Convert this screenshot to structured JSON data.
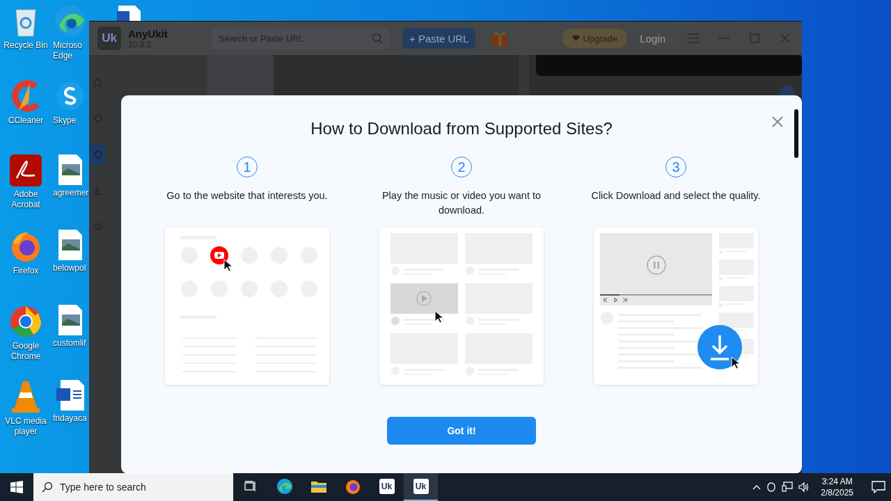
{
  "desktop_icons": [
    {
      "label": "Recycle Bin",
      "kind": "recycle"
    },
    {
      "label": "Microso Edge",
      "kind": "edge"
    },
    {
      "label": "CCleaner",
      "kind": "ccleaner"
    },
    {
      "label": "Skype",
      "kind": "skype"
    },
    {
      "label": "Adobe Acrobat",
      "kind": "acrobat"
    },
    {
      "label": "agreemer",
      "kind": "image"
    },
    {
      "label": "Firefox",
      "kind": "firefox"
    },
    {
      "label": "belowpol",
      "kind": "image"
    },
    {
      "label": "Google Chrome",
      "kind": "chrome"
    },
    {
      "label": "customlif",
      "kind": "image"
    },
    {
      "label": "VLC media player",
      "kind": "vlc"
    },
    {
      "label": "fridayaca",
      "kind": "word"
    }
  ],
  "app": {
    "logo_text": "Uk",
    "name": "AnyUkit",
    "version": "10.8.2",
    "search": {
      "placeholder": "Search or Paste URL"
    },
    "paste_button": "+ Paste URL",
    "upgrade_button": "Upgrade",
    "login": "Login",
    "sidebar": [
      {
        "kind": "home",
        "selected": false
      },
      {
        "kind": "search",
        "selected": false
      },
      {
        "kind": "globe",
        "selected": true
      },
      {
        "kind": "download",
        "selected": false
      },
      {
        "kind": "check",
        "selected": false
      }
    ]
  },
  "dialog": {
    "title": "How to Download from Supported Sites?",
    "steps": [
      {
        "number": "1",
        "text": "Go to the website that interests you.",
        "kind": "sites"
      },
      {
        "number": "2",
        "text": "Play the music or video you want to download.",
        "kind": "videos"
      },
      {
        "number": "3",
        "text": "Click Download and select the quality.",
        "kind": "player"
      }
    ],
    "button": "Got it!"
  },
  "taskbar": {
    "search_placeholder": "Type here to search",
    "apps": [
      {
        "kind": "taskview",
        "selected": false
      },
      {
        "kind": "edge",
        "selected": false
      },
      {
        "kind": "explorer",
        "selected": false
      },
      {
        "kind": "firefox",
        "selected": false
      },
      {
        "kind": "uk",
        "label": "Uk",
        "selected": false
      },
      {
        "kind": "uk",
        "label": "Uk",
        "selected": true
      }
    ],
    "time": "3:24 AM",
    "date": "2/8/2025"
  }
}
